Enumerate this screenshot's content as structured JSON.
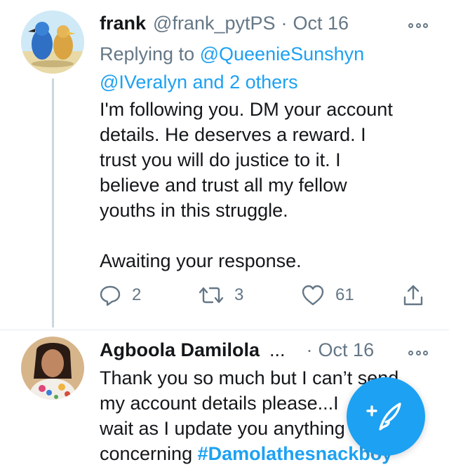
{
  "tweets": [
    {
      "name": "frank",
      "handle": "@frank_pytPS",
      "separator": "·",
      "date": "Oct 16",
      "replying_prefix": "Replying to",
      "mention_1": "@QueenieSunshyn",
      "mention_2": "@IVeralyn",
      "mention_and": "and",
      "mention_others": "2 others",
      "body": [
        "I'm following you. DM your account",
        "details. He deserves a reward. I",
        "trust you will do justice to it. I",
        "believe and trust all my fellow",
        "youths in this struggle.",
        "Awaiting your response."
      ],
      "replies": "2",
      "retweets": "3",
      "likes": "61"
    },
    {
      "name": "Agboola Damilola",
      "name_trunc": "...",
      "separator": "·",
      "date": "Oct 16",
      "body": [
        "Thank you so much but I can’t send",
        "my account details please...I",
        "wait as I update you anything",
        "concerning"
      ],
      "hashtag": "#Damolathesnackboy"
    }
  ],
  "icons": {
    "reply": "reply-icon",
    "retweet": "retweet-icon",
    "like": "heart-icon",
    "share": "share-icon",
    "more": "more-options-icon",
    "compose": "compose-tweet-icon"
  },
  "colors": {
    "accent": "#1da1f2",
    "secondary_text": "#657786",
    "primary_text": "#14171a"
  }
}
